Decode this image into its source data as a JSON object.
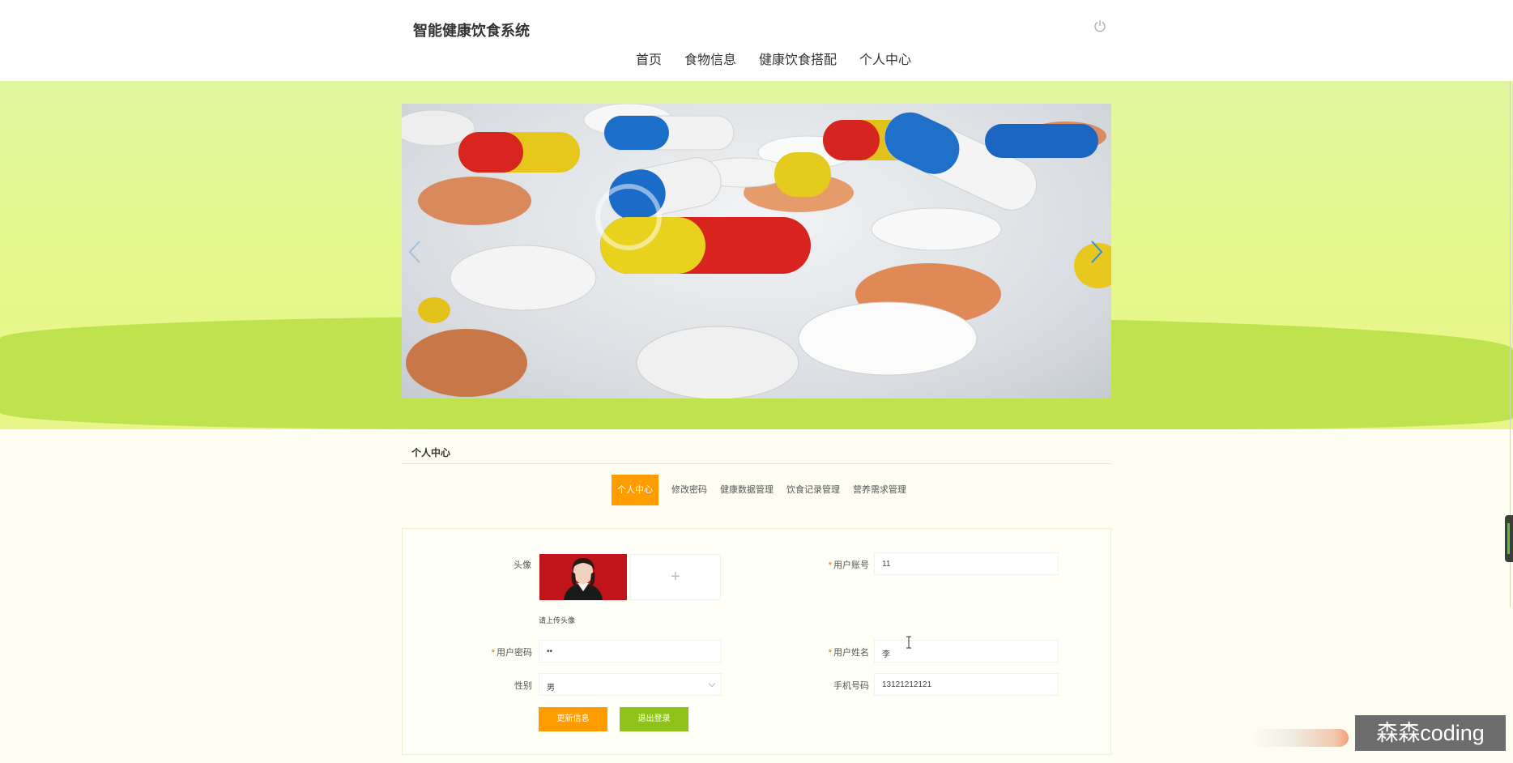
{
  "header": {
    "site_title": "智能健康饮食系统",
    "nav": [
      "首页",
      "食物信息",
      "健康饮食搭配",
      "个人中心"
    ]
  },
  "section": {
    "title": "个人中心",
    "tabs": [
      "个人中心",
      "修改密码",
      "健康数据管理",
      "饮食记录管理",
      "营养需求管理"
    ],
    "active_tab": "个人中心"
  },
  "form": {
    "avatar_label": "头像",
    "upload_plus": "+",
    "upload_hint": "请上传头像",
    "account_label": "用户账号",
    "account_value": "11",
    "password_label": "用户密码",
    "password_value": "••",
    "name_label": "用户姓名",
    "name_value": "李",
    "gender_label": "性别",
    "gender_value": "男",
    "phone_label": "手机号码",
    "phone_value": "13121212121",
    "update_button": "更新信息",
    "logout_button": "退出登录"
  },
  "overlay": {
    "watermark": "森森coding"
  },
  "colors": {
    "accent_orange": "#ff9d00",
    "accent_green": "#8ec31a",
    "band_light": "#e6f88a",
    "band_dark": "#bfe34f"
  }
}
